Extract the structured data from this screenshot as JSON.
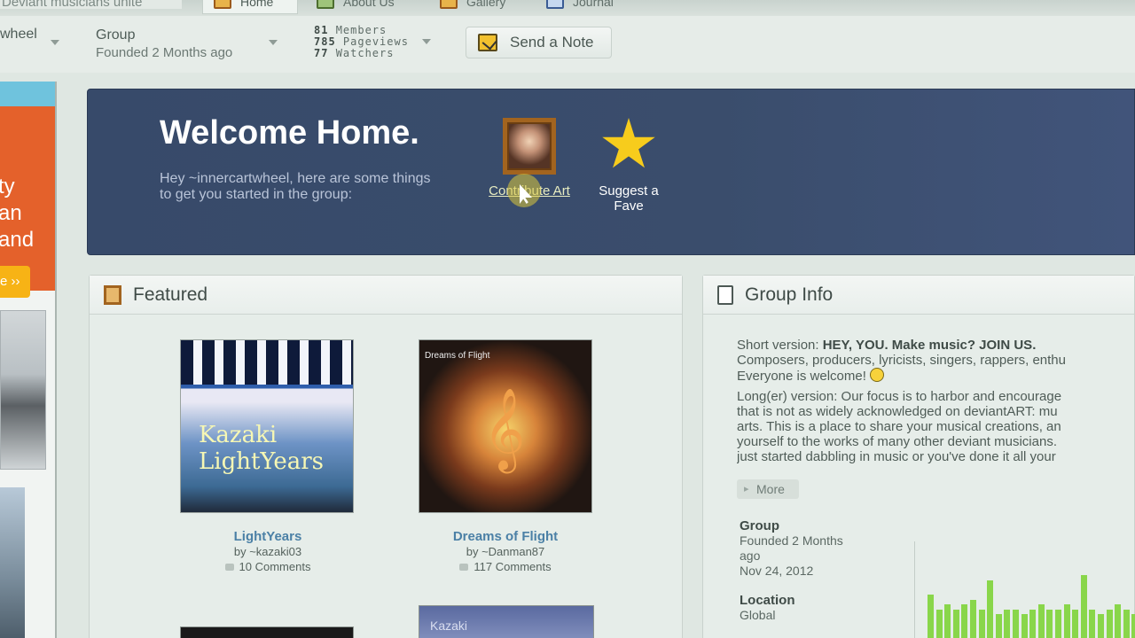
{
  "tabs": {
    "group_name": "Deviant musicians unite",
    "items": [
      {
        "label": "Home",
        "icon": "home-icon",
        "active": true
      },
      {
        "label": "About Us",
        "icon": "crown-icon",
        "active": false
      },
      {
        "label": "Gallery",
        "icon": "gallery-icon",
        "active": false
      },
      {
        "label": "Journal",
        "icon": "journal-icon",
        "active": false
      }
    ]
  },
  "header": {
    "user_partial": "wheel",
    "group_type": "Group",
    "founded": "Founded 2 Months ago",
    "stats": {
      "members": "81",
      "members_label": "Members",
      "pageviews": "785",
      "pageviews_label": "Pageviews",
      "watchers": "77",
      "watchers_label": "Watchers"
    },
    "send_note_label": "Send a Note"
  },
  "sidebar": {
    "promo_lines": [
      "ty",
      "an",
      "and"
    ],
    "promo_button": "e ››"
  },
  "welcome": {
    "title": "Welcome Home.",
    "intro": "Hey ~innercartwheel, here are some things to get you started in the group:",
    "contribute_label": "Contribute Art",
    "suggest_label": "Suggest a Fave"
  },
  "featured": {
    "title": "Featured",
    "items": [
      {
        "title": "LightYears",
        "author": "by ~kazaki03",
        "comments": "10 Comments",
        "thumb_text": "Kazaki LightYears"
      },
      {
        "title": "Dreams of Flight",
        "author": "by ~Danman87",
        "comments": "117 Comments",
        "thumb_text": "Dreams of Flight"
      }
    ],
    "partial_thumb_text": "Kazaki"
  },
  "group_info": {
    "title": "Group Info",
    "short_label": "Short version:",
    "short_bold": "HEY, YOU. Make music? JOIN US.",
    "short_line2": "Composers, producers, lyricists, singers, rappers, enthu",
    "short_line3": "Everyone is welcome!",
    "long_lines": [
      "Long(er) version: Our focus is to harbor and encourage",
      "that is not as widely acknowledged on deviantART: mu",
      "arts. This is a place to share your musical creations, an",
      "yourself to the works of many other deviant musicians.",
      "just started dabbling in music or you've done it all your"
    ],
    "more_label": "More",
    "group_heading": "Group",
    "group_founded_1": "Founded 2 Months",
    "group_founded_2": "ago",
    "group_date": "Nov 24, 2012",
    "location_heading": "Location",
    "location_value": "Global",
    "activity_bars": [
      0.45,
      0.3,
      0.35,
      0.3,
      0.35,
      0.4,
      0.3,
      0.6,
      0.25,
      0.3,
      0.3,
      0.25,
      0.3,
      0.35,
      0.3,
      0.3,
      0.35,
      0.3,
      0.65,
      0.3,
      0.25,
      0.3,
      0.35,
      0.3,
      0.25,
      0.3,
      0.3
    ]
  }
}
